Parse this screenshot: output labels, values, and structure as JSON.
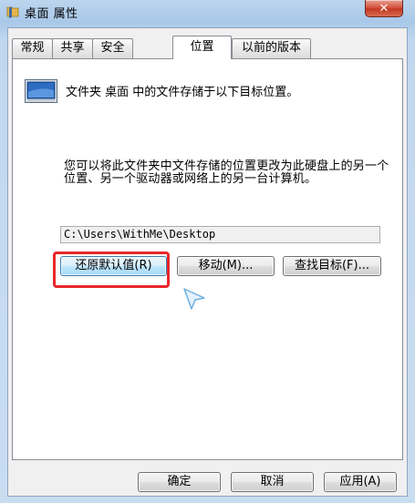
{
  "window": {
    "title": "桌面 属性",
    "close_label": "✕",
    "title_icon": "folder-icon"
  },
  "tabs": [
    {
      "label": "常规",
      "active": false
    },
    {
      "label": "共享",
      "active": false
    },
    {
      "label": "安全",
      "active": false
    },
    {
      "label": "位置",
      "active": true
    },
    {
      "label": "以前的版本",
      "active": false
    }
  ],
  "location": {
    "folder_icon": "folder-icon",
    "heading": "文件夹 桌面 中的文件存储于以下目标位置。",
    "description": "您可以将此文件夹中文件存储的位置更改为此硬盘上的另一个位置、另一个驱动器或网络上的另一台计算机。",
    "path_value": "C:\\Users\\WithMe\\Desktop",
    "restore_default_label": "还原默认值(R)",
    "move_label": "移动(M)...",
    "find_target_label": "查找目标(F)..."
  },
  "footer": {
    "ok_label": "确定",
    "cancel_label": "取消",
    "apply_label": "应用(A)"
  },
  "colors": {
    "highlight": "#e8262a",
    "close_button": "#c43a23"
  }
}
